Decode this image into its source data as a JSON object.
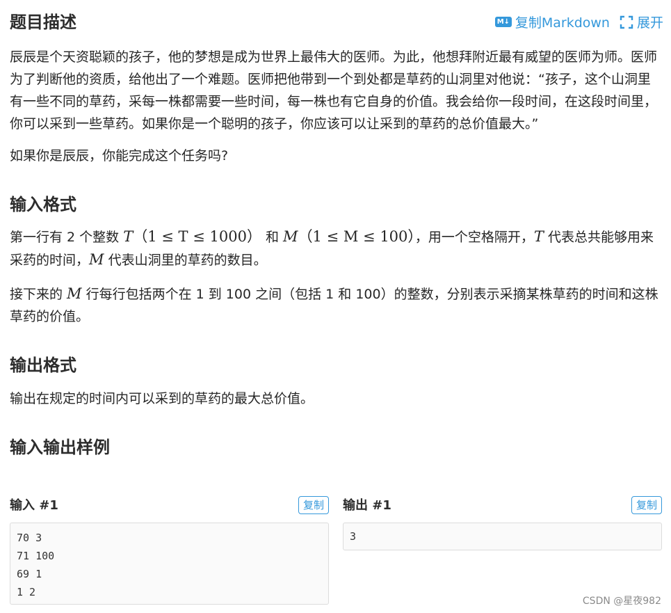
{
  "toolbar": {
    "copy_markdown": "复制Markdown",
    "expand": "展开"
  },
  "description": {
    "title": "题目描述",
    "p1": "辰辰是个天资聪颖的孩子，他的梦想是成为世界上最伟大的医师。为此，他想拜附近最有威望的医师为师。医师为了判断他的资质，给他出了一个难题。医师把他带到一个到处都是草药的山洞里对他说：“孩子，这个山洞里有一些不同的草药，采每一株都需要一些时间，每一株也有它自身的价值。我会给你一段时间，在这段时间里，你可以采到一些草药。如果你是一个聪明的孩子，你应该可以让采到的草药的总价值最大。”",
    "p2": "如果你是辰辰，你能完成这个任务吗?"
  },
  "input_format": {
    "title": "输入格式",
    "p1_a": "第一行有 2 个整数 ",
    "var_T": "T",
    "range_T": "（1 ≤ T ≤ 1000）",
    "p1_b": " 和 ",
    "var_M": "M",
    "range_M": "（1 ≤ M ≤ 100）",
    "p1_c": "，用一个空格隔开，",
    "p1_d": " 代表总共能够用来采药的时间，",
    "p1_e": " 代表山洞里的草药的数目。",
    "p2_a": "接下来的 ",
    "p2_b": " 行每行包括两个在 1 到 100 之间（包括 1 和 100）的整数，分别表示采摘某株草药的时间和这株草药的价值。"
  },
  "output_format": {
    "title": "输出格式",
    "p1": "输出在规定的时间内可以采到的草药的最大总价值。"
  },
  "samples": {
    "title": "输入输出样例",
    "input_title": "输入 #1",
    "output_title": "输出 #1",
    "copy_label": "复制",
    "input_lines": [
      "70 3",
      "71 100",
      "69 1",
      "1 2"
    ],
    "output_lines": [
      "3"
    ]
  },
  "watermark": "CSDN @星夜982",
  "colors": {
    "accent": "#3498db",
    "text": "#262626"
  }
}
